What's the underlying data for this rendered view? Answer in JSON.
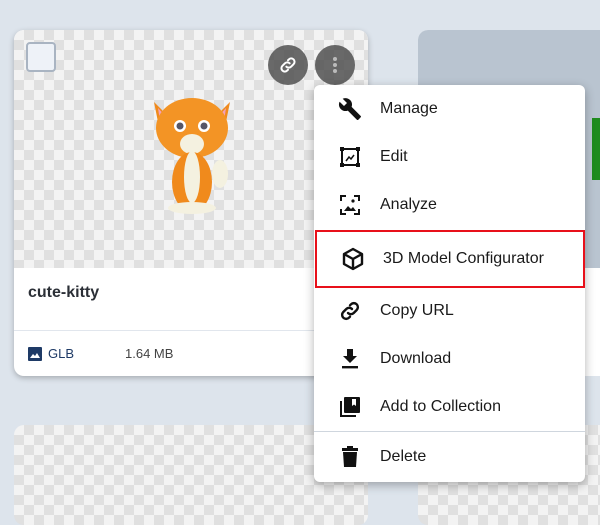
{
  "asset": {
    "name": "cute-kitty",
    "format": "GLB",
    "size": "1.64 MB"
  },
  "menu": {
    "items": [
      {
        "label": "Manage",
        "icon": "wrench-icon"
      },
      {
        "label": "Edit",
        "icon": "edit-crop-icon"
      },
      {
        "label": "Analyze",
        "icon": "analyze-image-icon"
      },
      {
        "label": "3D Model Configurator",
        "icon": "cube-icon",
        "highlighted": true
      },
      {
        "label": "Copy URL",
        "icon": "link-icon"
      },
      {
        "label": "Download",
        "icon": "download-icon"
      },
      {
        "label": "Add to Collection",
        "icon": "collection-icon"
      },
      {
        "label": "Delete",
        "icon": "trash-icon"
      }
    ]
  },
  "colors": {
    "highlight": "#e8101a",
    "background": "#dde4ec",
    "format_label": "#1e3a66"
  }
}
